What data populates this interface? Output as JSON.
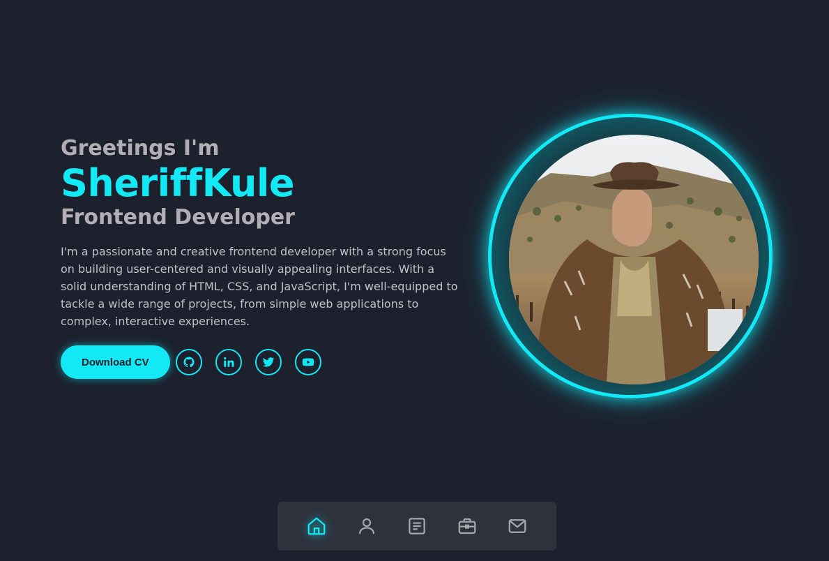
{
  "hero": {
    "greeting": "Greetings I'm",
    "name": "SheriffKule",
    "role": "Frontend Developer",
    "bio": "I'm a passionate and creative frontend developer with a strong focus on building user-centered and visually appealing interfaces. With a solid understanding of HTML, CSS, and JavaScript, I'm well-equipped to tackle a wide range of projects, from simple web applications to complex, interactive experiences.",
    "cv_button": "Download CV"
  },
  "social": [
    {
      "icon": "github-icon"
    },
    {
      "icon": "linkedin-icon"
    },
    {
      "icon": "twitter-icon"
    },
    {
      "icon": "youtube-icon"
    }
  ],
  "nav": [
    {
      "icon": "home-icon",
      "active": true
    },
    {
      "icon": "user-icon",
      "active": false
    },
    {
      "icon": "document-icon",
      "active": false
    },
    {
      "icon": "briefcase-icon",
      "active": false
    },
    {
      "icon": "mail-icon",
      "active": false
    }
  ],
  "colors": {
    "background": "#1c212d",
    "accent": "#13e8f5",
    "muted_text": "#b3aeb6",
    "nav_background": "#2d323d"
  }
}
